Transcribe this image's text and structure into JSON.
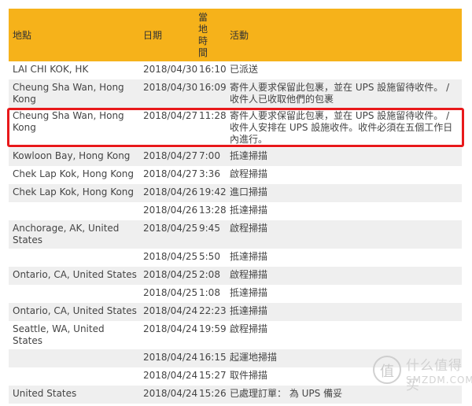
{
  "headers": {
    "location": "地點",
    "date": "日期",
    "local_time": "當地時間",
    "activity": "活動"
  },
  "rows": [
    {
      "location": "LAI CHI KOK, HK",
      "date": "2018/04/30",
      "time": "16:10",
      "activity": "已派送"
    },
    {
      "location": "Cheung Sha Wan, Hong Kong",
      "date": "2018/04/30",
      "time": "16:09",
      "activity": "寄件人要求保留此包裹，並在 UPS 設施留待收件。 / 收件人已收取他們的包裹"
    },
    {
      "location": "Cheung Sha Wan, Hong Kong",
      "date": "2018/04/27",
      "time": "11:28",
      "activity": "寄件人要求保留此包裹，並在 UPS 設施留待收件。 / 收件人安排在 UPS 設施收件。收件必須在五個工作日內進行。"
    },
    {
      "location": "Kowloon Bay, Hong Kong",
      "date": "2018/04/27",
      "time": "7:00",
      "activity": "抵達掃描"
    },
    {
      "location": "Chek Lap Kok, Hong Kong",
      "date": "2018/04/27",
      "time": "3:36",
      "activity": "啟程掃描"
    },
    {
      "location": "Chek Lap Kok, Hong Kong",
      "date": "2018/04/26",
      "time": "19:42",
      "activity": "進口掃描"
    },
    {
      "location": "",
      "date": "2018/04/26",
      "time": "13:28",
      "activity": "抵達掃描"
    },
    {
      "location": "Anchorage, AK, United States",
      "date": "2018/04/25",
      "time": "9:45",
      "activity": "啟程掃描"
    },
    {
      "location": "",
      "date": "2018/04/25",
      "time": "5:50",
      "activity": "抵達掃描"
    },
    {
      "location": "Ontario, CA, United States",
      "date": "2018/04/25",
      "time": "2:08",
      "activity": "啟程掃描"
    },
    {
      "location": "",
      "date": "2018/04/25",
      "time": "1:08",
      "activity": "抵達掃描"
    },
    {
      "location": "Ontario, CA, United States",
      "date": "2018/04/24",
      "time": "22:23",
      "activity": "抵達掃描"
    },
    {
      "location": "Seattle, WA, United States",
      "date": "2018/04/24",
      "time": "19:59",
      "activity": "啟程掃描"
    },
    {
      "location": "",
      "date": "2018/04/24",
      "time": "16:15",
      "activity": "起運地掃描"
    },
    {
      "location": "",
      "date": "2018/04/24",
      "time": "15:27",
      "activity": "取件掃描"
    },
    {
      "location": "United States",
      "date": "2018/04/24",
      "time": "15:26",
      "activity": "已處理訂單： 為 UPS 備妥"
    }
  ],
  "watermark": {
    "cn": "什么值得买",
    "en": "SMZDM.COM"
  },
  "colors": {
    "header_bg": "#f6b21a",
    "alt_row_bg": "#efefef",
    "highlight_border": "#e8191b"
  }
}
